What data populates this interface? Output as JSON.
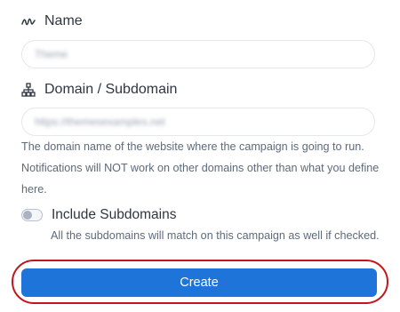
{
  "form": {
    "name": {
      "label": "Name",
      "icon": "signature-icon",
      "value": "Theme"
    },
    "domain": {
      "label": "Domain / Subdomain",
      "icon": "sitemap-icon",
      "value": "https://themesexamples.net",
      "help": "The domain name of the website where the campaign is going to run. Notifications will NOT work on other domains other than what you define here."
    },
    "include_subdomains": {
      "label": "Include Subdomains",
      "checked": false,
      "help": "All the subdomains will match on this campaign as well if checked."
    },
    "create_label": "Create"
  },
  "colors": {
    "primary": "#1e74d9",
    "highlight": "#c0161d",
    "text": "#2f3640",
    "muted": "#5e6a7a",
    "border": "#e3e7ee"
  }
}
